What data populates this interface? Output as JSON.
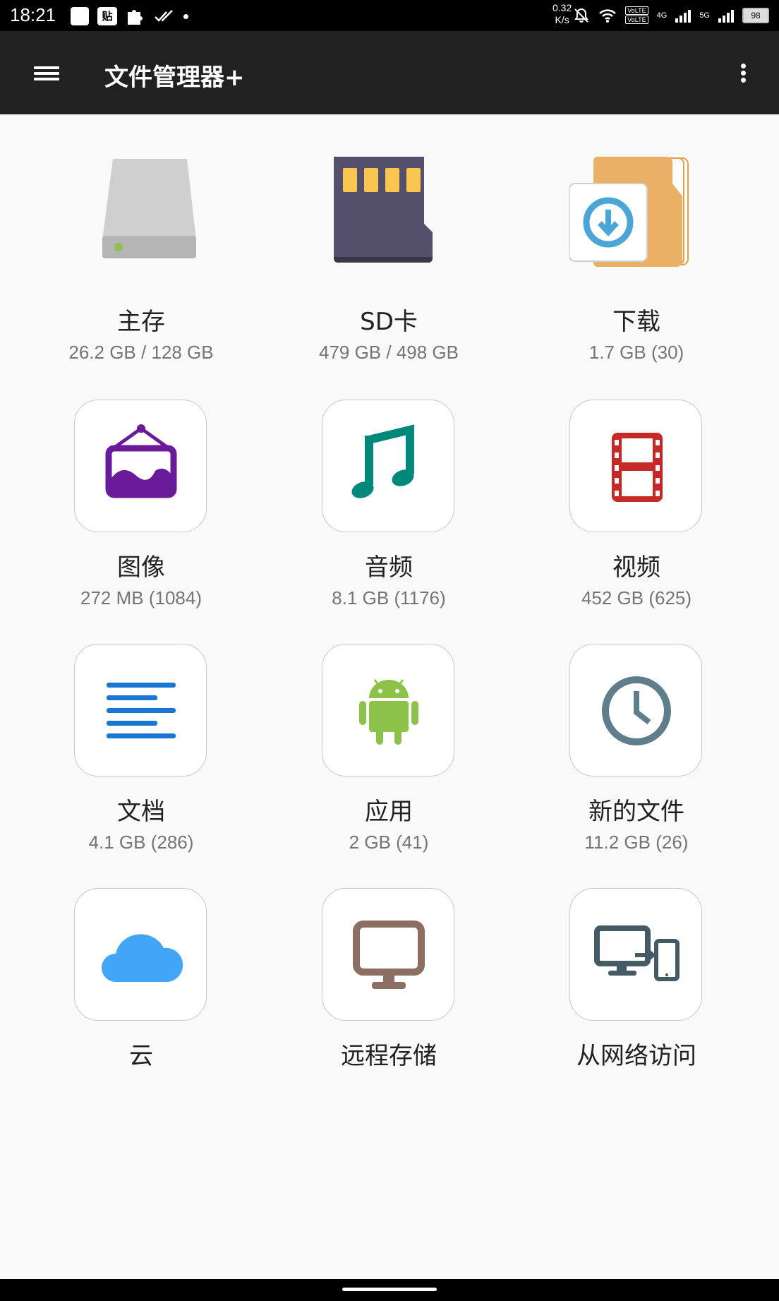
{
  "status_bar": {
    "time": "18:21",
    "net_speed_value": "0.32",
    "net_speed_unit": "K/s",
    "notification_icon": "贴",
    "battery": "98",
    "volte1": "VoLTE",
    "volte2": "VoLTE",
    "net1": "4G",
    "net2": "5G"
  },
  "app_bar": {
    "title": "文件管理器+"
  },
  "tiles": [
    {
      "label": "主存",
      "sub": "26.2 GB / 128 GB",
      "icon": "hard-drive-icon"
    },
    {
      "label": "SD卡",
      "sub": "479 GB / 498 GB",
      "icon": "sd-card-icon"
    },
    {
      "label": "下载",
      "sub": "1.7 GB (30)",
      "icon": "download-folder-icon"
    },
    {
      "label": "图像",
      "sub": "272 MB (1084)",
      "icon": "image-icon",
      "color": "#6a1b9a"
    },
    {
      "label": "音频",
      "sub": "8.1 GB (1176)",
      "icon": "music-note-icon",
      "color": "#00897b"
    },
    {
      "label": "视频",
      "sub": "452 GB (625)",
      "icon": "film-icon",
      "color": "#c62828"
    },
    {
      "label": "文档",
      "sub": "4.1 GB (286)",
      "icon": "document-lines-icon",
      "color": "#1976d2"
    },
    {
      "label": "应用",
      "sub": "2 GB (41)",
      "icon": "android-icon",
      "color": "#8bc34a"
    },
    {
      "label": "新的文件",
      "sub": "11.2 GB (26)",
      "icon": "clock-icon",
      "color": "#607d8b"
    },
    {
      "label": "云",
      "sub": "",
      "icon": "cloud-icon",
      "color": "#42a5f5"
    },
    {
      "label": "远程存储",
      "sub": "",
      "icon": "monitor-icon",
      "color": "#8d6e63"
    },
    {
      "label": "从网络访问",
      "sub": "",
      "icon": "network-devices-icon",
      "color": "#455a64"
    }
  ]
}
